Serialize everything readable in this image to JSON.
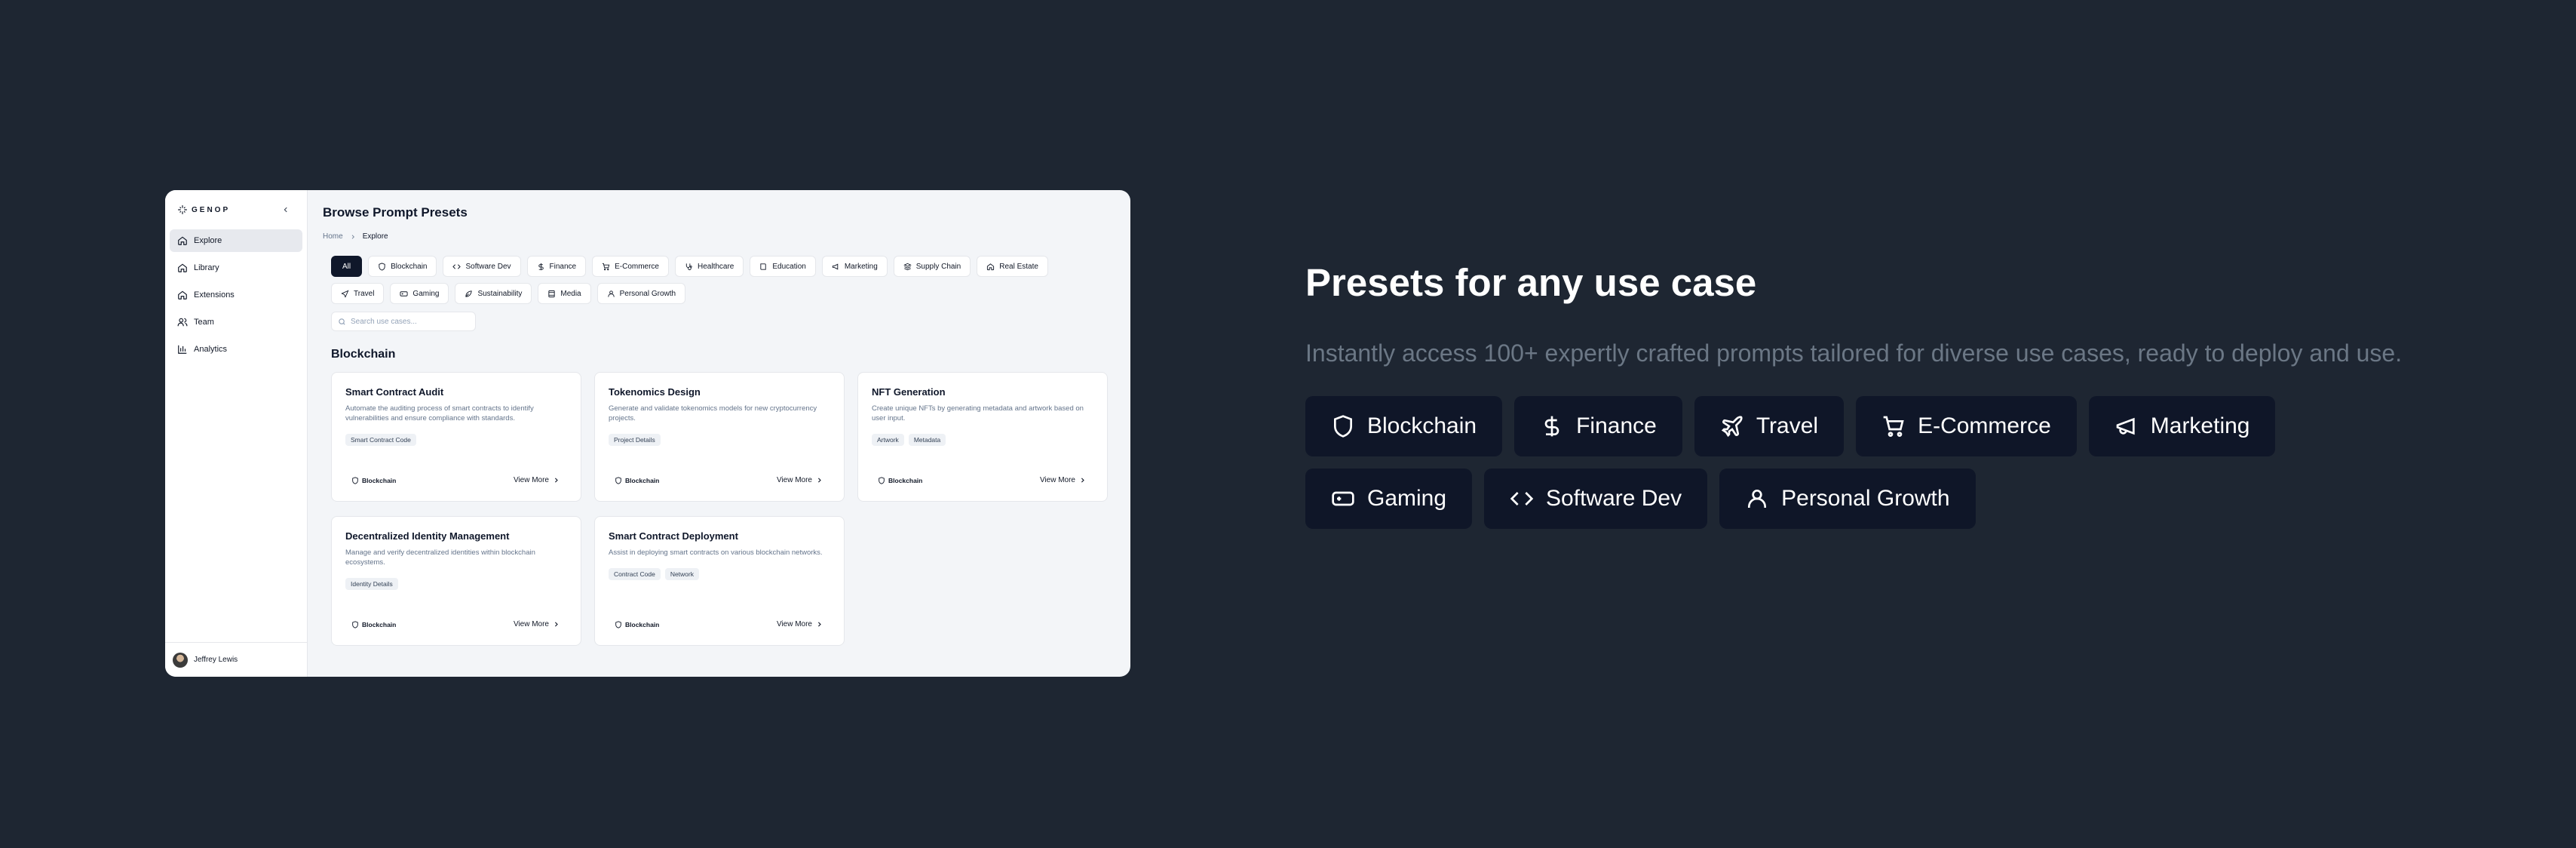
{
  "app": {
    "brand": "GENOP",
    "page_title": "Browse Prompt Presets",
    "breadcrumb": {
      "home": "Home",
      "current": "Explore"
    },
    "sidebar": {
      "items": [
        {
          "label": "Explore",
          "icon": "home-icon",
          "active": true
        },
        {
          "label": "Library",
          "icon": "home-icon"
        },
        {
          "label": "Extensions",
          "icon": "home-icon"
        },
        {
          "label": "Team",
          "icon": "users-icon"
        },
        {
          "label": "Analytics",
          "icon": "bar-chart-icon"
        }
      ],
      "user_name": "Jeffrey Lewis"
    },
    "filters": [
      {
        "label": "All",
        "active": true
      },
      {
        "label": "Blockchain",
        "icon": "shield-icon"
      },
      {
        "label": "Software Dev",
        "icon": "code-icon"
      },
      {
        "label": "Finance",
        "icon": "dollar-icon"
      },
      {
        "label": "E-Commerce",
        "icon": "cart-icon"
      },
      {
        "label": "Healthcare",
        "icon": "stethoscope-icon"
      },
      {
        "label": "Education",
        "icon": "book-icon"
      },
      {
        "label": "Marketing",
        "icon": "megaphone-icon"
      },
      {
        "label": "Supply Chain",
        "icon": "boxes-icon"
      },
      {
        "label": "Real Estate",
        "icon": "home-icon"
      },
      {
        "label": "Travel",
        "icon": "plane-icon"
      },
      {
        "label": "Gaming",
        "icon": "gamepad-icon"
      },
      {
        "label": "Sustainability",
        "icon": "leaf-icon"
      },
      {
        "label": "Media",
        "icon": "film-icon"
      },
      {
        "label": "Personal Growth",
        "icon": "user-icon"
      }
    ],
    "search_placeholder": "Search use cases...",
    "section_title": "Blockchain",
    "cards": [
      {
        "title": "Smart Contract Audit",
        "description": "Automate the auditing process of smart contracts to identify vulnerabilities and ensure compliance with standards.",
        "tags": [
          "Smart Contract Code"
        ],
        "category": "Blockchain",
        "action": "View More"
      },
      {
        "title": "Tokenomics Design",
        "description": "Generate and validate tokenomics models for new cryptocurrency projects.",
        "tags": [
          "Project Details"
        ],
        "category": "Blockchain",
        "action": "View More"
      },
      {
        "title": "NFT Generation",
        "description": "Create unique NFTs by generating metadata and artwork based on user input.",
        "tags": [
          "Artwork",
          "Metadata"
        ],
        "category": "Blockchain",
        "action": "View More"
      },
      {
        "title": "Decentralized Identity Management",
        "description": "Manage and verify decentralized identities within blockchain ecosystems.",
        "tags": [
          "Identity Details"
        ],
        "category": "Blockchain",
        "action": "View More"
      },
      {
        "title": "Smart Contract Deployment",
        "description": "Assist in deploying smart contracts on various blockchain networks.",
        "tags": [
          "Contract Code",
          "Network"
        ],
        "category": "Blockchain",
        "action": "View More"
      }
    ]
  },
  "hero": {
    "title": "Presets for any use case",
    "subtitle": "Instantly access 100+ expertly crafted prompts tailored for diverse use cases, ready to deploy and use.",
    "pills": [
      {
        "label": "Blockchain",
        "icon": "shield-icon"
      },
      {
        "label": "Finance",
        "icon": "dollar-icon"
      },
      {
        "label": "Travel",
        "icon": "plane-icon"
      },
      {
        "label": "E-Commerce",
        "icon": "cart-icon"
      },
      {
        "label": "Marketing",
        "icon": "megaphone-icon"
      },
      {
        "label": "Gaming",
        "icon": "gamepad-icon"
      },
      {
        "label": "Software Dev",
        "icon": "code-icon"
      },
      {
        "label": "Personal Growth",
        "icon": "user-icon"
      }
    ]
  },
  "colors": {
    "background": "#1e2632",
    "app_background": "#f3f5f8",
    "pill_background": "#0f1628",
    "primary": "#0f172a",
    "muted_text": "#64748b",
    "hero_subtitle": "#6b7785"
  }
}
